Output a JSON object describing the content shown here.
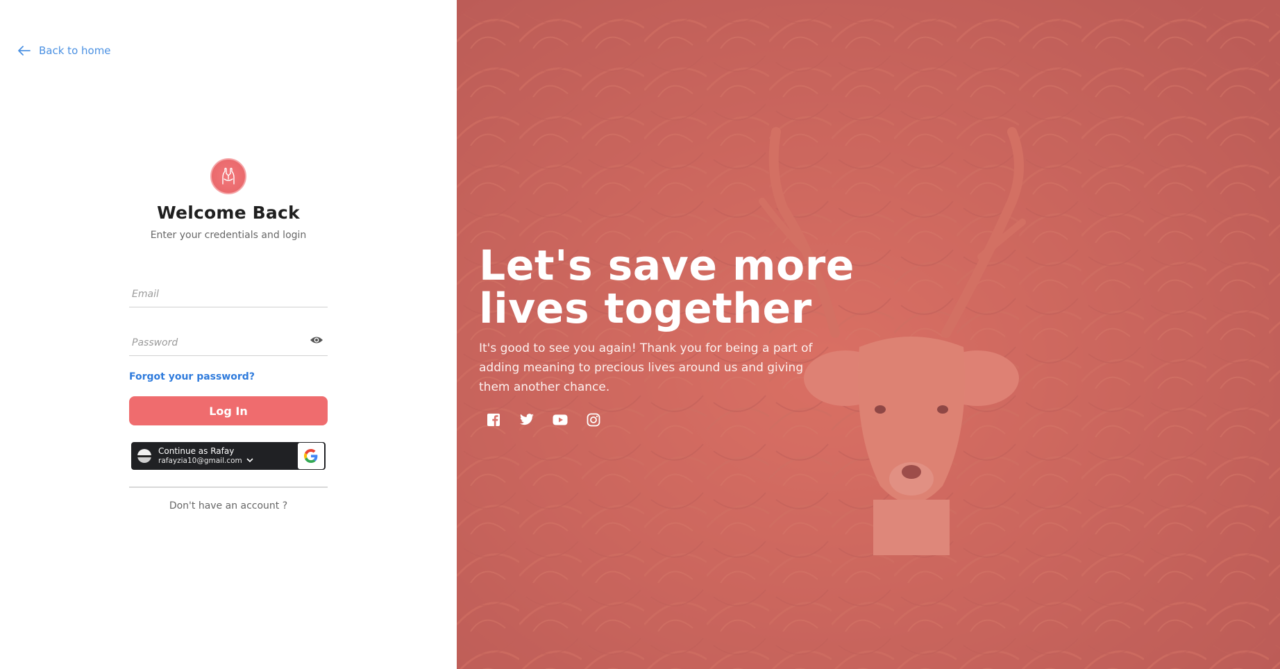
{
  "nav": {
    "back_label": "Back to home"
  },
  "login": {
    "title": "Welcome Back",
    "subtitle": "Enter your credentials and login",
    "email_placeholder": "Email",
    "email_value": "",
    "password_placeholder": "Password",
    "password_value": "",
    "forgot_label": "Forgot your password?",
    "login_label": "Log In",
    "signup_prompt": "Don't have an account ?"
  },
  "google": {
    "continue_label": "Continue as Rafay",
    "email": "rafayzia10@gmail.com"
  },
  "hero": {
    "title": "Let's save more lives together",
    "description": "It's good to see you again! Thank you for being a part of adding meaning to precious lives around us and giving them another chance.",
    "socials": [
      "facebook-icon",
      "twitter-icon",
      "youtube-icon",
      "instagram-icon"
    ]
  },
  "colors": {
    "accent": "#ef6c6e",
    "link": "#2f7bdc",
    "back_link": "#4a90e2",
    "hero_overlay": "#d66864"
  }
}
